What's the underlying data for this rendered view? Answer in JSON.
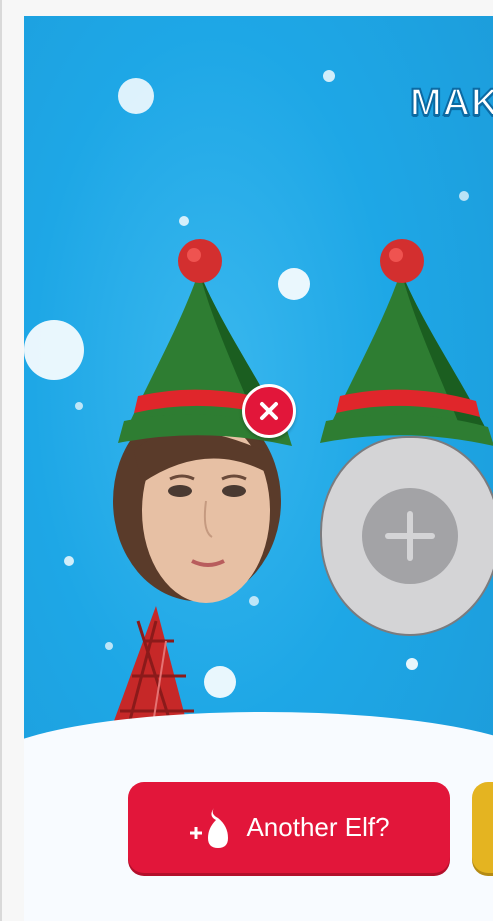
{
  "banner": {
    "title": "MAKE"
  },
  "elves": [
    {
      "slot": "photo-face",
      "has_remove": true
    },
    {
      "slot": "empty-face",
      "has_add": true
    }
  ],
  "actions": {
    "another_elf_label": "Another Elf?",
    "second_button_label": ""
  },
  "colors": {
    "sky": "#1ea7e6",
    "hat_green": "#2e7d32",
    "hat_band": "#e0262b",
    "remove_badge": "#e2163a",
    "another_button": "#e2163a",
    "second_button": "#e4b421"
  },
  "icons": [
    "close-icon",
    "add-photo-icon",
    "plus-icon",
    "elf-shoe-icon"
  ]
}
